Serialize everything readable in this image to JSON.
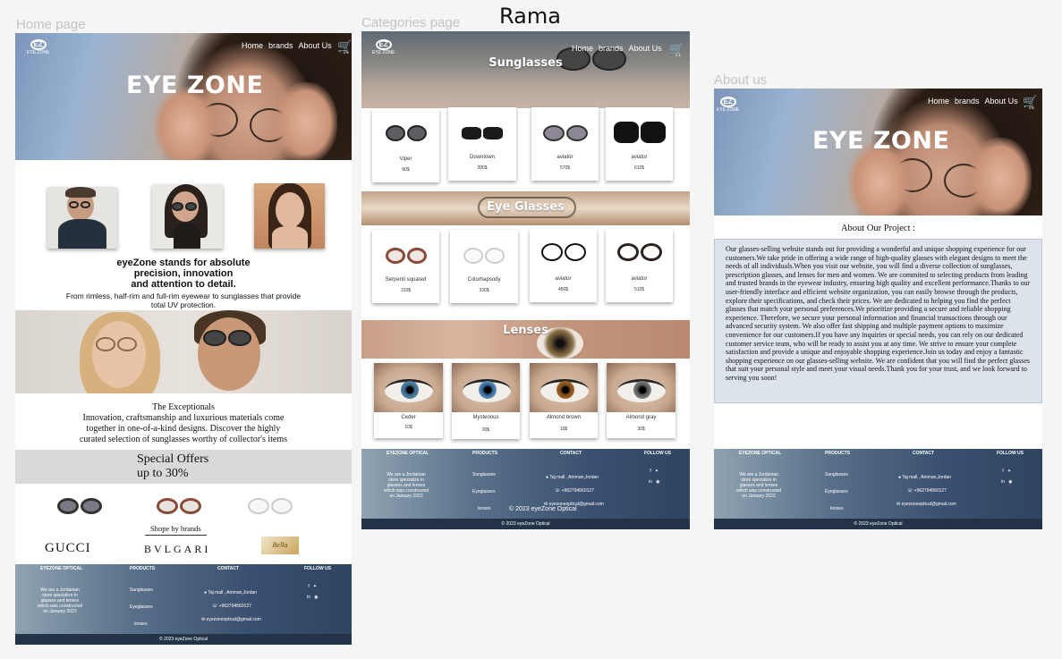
{
  "labels": {
    "home": "Home page",
    "categories": "Categories page",
    "about": "About us",
    "author": "Rama"
  },
  "nav": {
    "home": "Home",
    "brands": "brands",
    "about": "About Us",
    "cart_count": "0 $"
  },
  "logo": {
    "mark": "EZ",
    "text": "EYE ZONE"
  },
  "home": {
    "hero_title": "EYE ZONE",
    "headline": [
      "eyeZone stands for absolute",
      "precision, innovation",
      "and attention to detail."
    ],
    "subtext": [
      "From rimless, half-rim and full-rim eyewear to sunglasses that provide",
      "total UV protection."
    ],
    "exceptionals": [
      "The Exceptionals",
      "Innovation, craftsmanship and luxurious materials come",
      "together in one-of-a-kind designs. Discover the highly",
      "curated selection of sunglasses worthy of collector's items"
    ],
    "offers": [
      "Special Offers",
      "up to 30%"
    ],
    "shop_by_brands": "Shope by brands",
    "brands": [
      "GUCCI",
      "BVLGARI",
      "Bella"
    ]
  },
  "categories": {
    "sunglasses_title": "Sunglasses",
    "sunglasses": [
      {
        "name": "Viper",
        "price": "90$"
      },
      {
        "name": "Downtown",
        "price": "390$"
      },
      {
        "name": "aviator",
        "price": "570$"
      },
      {
        "name": "aviator",
        "price": "610$"
      }
    ],
    "eyeglasses_title": "Eye Glasses",
    "eyeglasses": [
      {
        "name": "Serpenti squared",
        "price": "310$"
      },
      {
        "name": "Colorhapsody",
        "price": "330$"
      },
      {
        "name": "aviator",
        "price": "450$"
      },
      {
        "name": "aviator",
        "price": "510$"
      }
    ],
    "lenses_title": "Lenses",
    "lenses": [
      {
        "name": "Ceder",
        "price": "10$"
      },
      {
        "name": "Mysterious",
        "price": "30$"
      },
      {
        "name": "Almond brown",
        "price": "10$"
      },
      {
        "name": "Almond gray",
        "price": "30$"
      }
    ]
  },
  "about": {
    "hero_title": "EYE ZONE",
    "heading": "About Our Project :",
    "body": "Our glasses-selling website stands out for providing a wonderful and unique shopping experience for our customers.We take pride in offering a wide range of high-quality glasses with elegant designs to meet the needs of all individuals.When you visit our website, you will find a diverse collection of sunglasses, prescription glasses, and lenses for men and women. We are commited to selecting products from leading and trusted brands in the eyewear industry, ensuring high quality and excellent performance.Thanks to our user-friendly interface and efficient website organization, you can easily browse through the products, explore their specifications, and check their prices. We are dedicated to helping you find the perfect glasses that match your personal preferences.We prioritize providing a secure and reliable shopping experience. Therefore, we secure your personal information and financial transactions through our advanced security system. We also offer fast shipping and multiple payment options to maximize convenience for our customers.If you have any inquiries or special needs, you can rely on our dedicated customer service team, who will be ready to assist you at any time. We strive to ensure your complete satisfaction and provide a unique and enjoyable shopping experience.Join us today and enjoy a fantastic shopping experience on our glasses-selling website. We are confident that you will find the perfect glasses that suit your personal style and meet your visual needs.Thank you for your trust, and we look forward to serving you soon!"
  },
  "footer": {
    "col1_title": "EYEZONE OPTICAL",
    "col1_title_alt": "EYEZONE OPTICAL",
    "col1_text": "We are a Jordanian store specialize in glasses and lenses which was constructed on January 2023",
    "col2_title": "PRODUCTS",
    "products": [
      "Sunglasses",
      "Eyeglasses",
      "lenses"
    ],
    "col3_title": "CONTACT",
    "address": "Taj mall , Amman,Jordan",
    "phone": "+962794560127",
    "email": "eyezoneoptical@gmail.com",
    "col4_title": "FOLLOW US",
    "copyright": "© 2023 eyeZone Optical"
  },
  "colors": {
    "footer": "#3a5070",
    "about_box": "#dde3ea",
    "special_band": "#d9d9d9"
  }
}
